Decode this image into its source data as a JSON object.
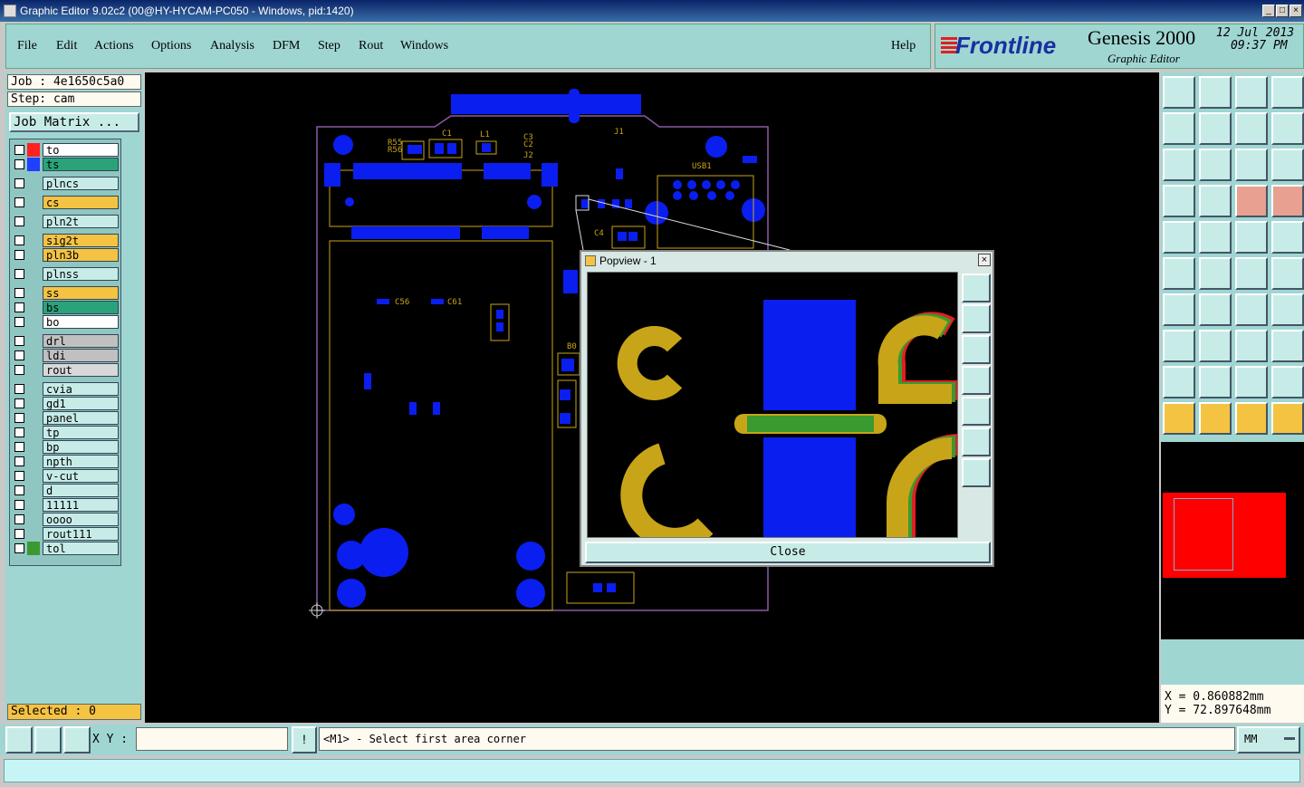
{
  "window": {
    "title": "Graphic Editor 9.02c2 (00@HY-HYCAM-PC050 - Windows, pid:1420)"
  },
  "menu": {
    "file": "File",
    "edit": "Edit",
    "actions": "Actions",
    "options": "Options",
    "analysis": "Analysis",
    "dfm": "DFM",
    "step": "Step",
    "rout": "Rout",
    "windows": "Windows",
    "help": "Help"
  },
  "brand": {
    "logo": "Frontline",
    "product": "Genesis 2000",
    "subtitle": "Graphic Editor",
    "date": "12 Jul 2013",
    "time": "09:37 PM"
  },
  "job": {
    "job_line": "Job : 4e1650c5a0",
    "step_line": "Step: cam",
    "matrix_label": "Job Matrix ..."
  },
  "layers": [
    {
      "name": "to",
      "color": "#ff2020",
      "bg": "#ffffff",
      "mark": true
    },
    {
      "name": "ts",
      "color": "#2040ff",
      "bg": "#2aa37a",
      "mark": false
    },
    {
      "name": "plncs",
      "color": "",
      "bg": "#c7ece8",
      "mark": false
    },
    {
      "name": "cs",
      "color": "",
      "bg": "#f5c342",
      "mark": true
    },
    {
      "name": "pln2t",
      "color": "",
      "bg": "#c7ece8",
      "mark": false
    },
    {
      "name": "sig2t",
      "color": "",
      "bg": "#f5c342",
      "mark": false
    },
    {
      "name": "pln3b",
      "color": "",
      "bg": "#f5c342",
      "mark": false
    },
    {
      "name": "plnss",
      "color": "",
      "bg": "#c7ece8",
      "mark": false
    },
    {
      "name": "ss",
      "color": "",
      "bg": "#f5c342",
      "mark": false
    },
    {
      "name": "bs",
      "color": "",
      "bg": "#2aa37a",
      "mark": false
    },
    {
      "name": "bo",
      "color": "",
      "bg": "#ffffff",
      "mark": true
    },
    {
      "name": "drl",
      "color": "",
      "bg": "#c0c0c0",
      "mark": false
    },
    {
      "name": "ldi",
      "color": "",
      "bg": "#c0c0c0",
      "mark": false
    },
    {
      "name": "rout",
      "color": "",
      "bg": "#d8d8d8",
      "mark": false
    },
    {
      "name": "cvia",
      "color": "",
      "bg": "#c7ece8",
      "mark": false
    },
    {
      "name": "gd1",
      "color": "",
      "bg": "#c7ece8",
      "mark": false
    },
    {
      "name": "panel",
      "color": "",
      "bg": "#c7ece8",
      "mark": false
    },
    {
      "name": "tp",
      "color": "",
      "bg": "#c7ece8",
      "mark": false
    },
    {
      "name": "bp",
      "color": "",
      "bg": "#c7ece8",
      "mark": false
    },
    {
      "name": "npth",
      "color": "",
      "bg": "#c7ece8",
      "mark": false
    },
    {
      "name": "v-cut",
      "color": "",
      "bg": "#c7ece8",
      "mark": false
    },
    {
      "name": "d",
      "color": "",
      "bg": "#c7ece8",
      "mark": false
    },
    {
      "name": "11111",
      "color": "",
      "bg": "#c7ece8",
      "mark": false
    },
    {
      "name": "oooo",
      "color": "",
      "bg": "#c7ece8",
      "mark": false
    },
    {
      "name": "rout111",
      "color": "",
      "bg": "#c7ece8",
      "mark": false
    },
    {
      "name": "tol",
      "color": "#3a9a30",
      "bg": "#c7ece8",
      "mark": true
    }
  ],
  "selected": "Selected : 0",
  "popup": {
    "title": "Popview - 1",
    "close": "Close"
  },
  "coords": {
    "x": "X = 0.860882mm",
    "y": "Y = 72.897648mm"
  },
  "bottom": {
    "xy_label": "X Y :",
    "xy_value": "",
    "message": "<M1> - Select first area corner",
    "units": "MM"
  },
  "colors": {
    "teal": "#9fd6d2",
    "copper": "#c8a418",
    "pad": "#0a1ef0",
    "highlight": "#f5c342"
  }
}
